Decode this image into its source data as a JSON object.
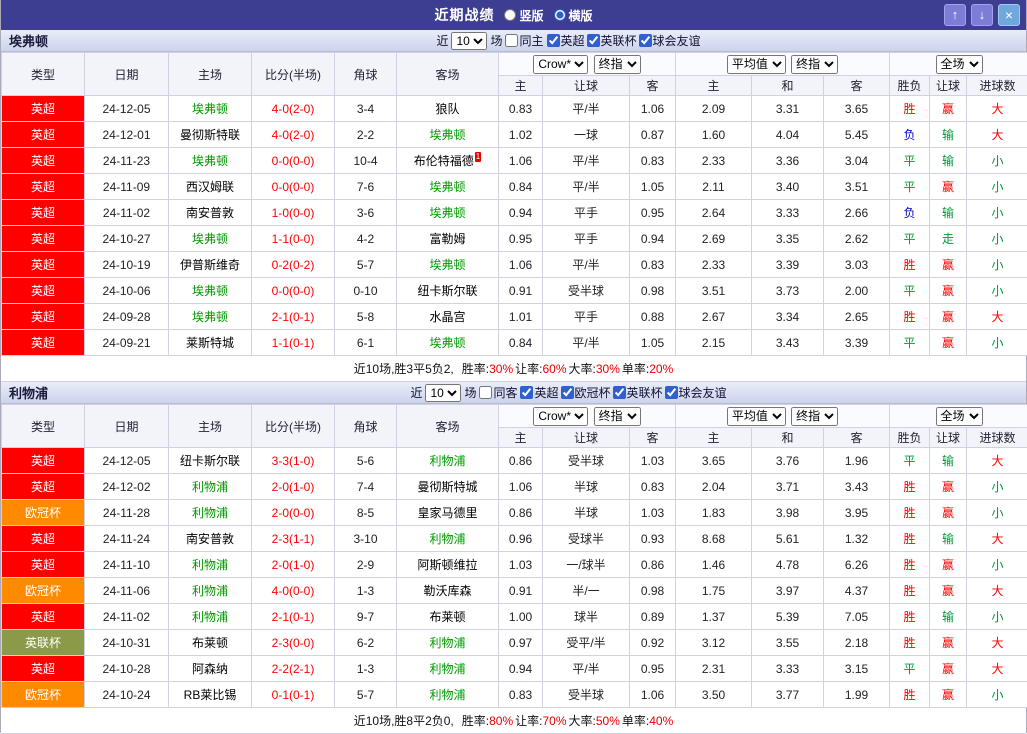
{
  "titlebar": {
    "title": "近期战绩",
    "layout_radios": [
      {
        "label": "竖版",
        "selected": false
      },
      {
        "label": "横版",
        "selected": true
      }
    ],
    "up_icon": "↑",
    "down_icon": "↓",
    "close_icon": "×"
  },
  "colors": {
    "focal_team": "#009900",
    "score": "#ff0000",
    "league": {
      "英超": "#fe0000",
      "欧冠杯": "#ff8a00",
      "英联杯": "#8a9a48"
    },
    "result": {
      "胜": "#ff0000",
      "平": "#009933",
      "负": "#0000cc"
    },
    "cover": {
      "赢": "#ff0000",
      "输": "#009933",
      "走": "#009933"
    },
    "goals": {
      "大": "#ff0000",
      "小": "#009933"
    },
    "stat_value": "#e60000"
  },
  "header": {
    "col_type": "类型",
    "col_date": "日期",
    "col_home": "主场",
    "col_score": "比分(半场)",
    "col_corner": "角球",
    "col_away": "客场",
    "asia_sub": [
      "主",
      "让球",
      "客"
    ],
    "euro_sub": [
      "主",
      "和",
      "客"
    ],
    "result_sub": [
      "胜负",
      "让球",
      "进球数"
    ]
  },
  "sections": [
    {
      "team": "埃弗顿",
      "filter": {
        "near": "近",
        "count": "10",
        "games": "场",
        "same": "同主",
        "leagues": [
          "英超",
          "英联杯",
          "球会友谊"
        ]
      },
      "selects": {
        "asia_company": "Crow*",
        "asia_time": "终指",
        "euro_company": "平均值",
        "euro_time": "终指",
        "scope": "全场"
      },
      "rows": [
        {
          "league": "英超",
          "date": "24-12-05",
          "home": "埃弗顿",
          "home_focal": true,
          "score": "4-0(2-0)",
          "corner": "3-4",
          "away": "狼队",
          "asia_home": "0.83",
          "handicap": "平/半",
          "asia_away": "1.06",
          "euro_home": "2.09",
          "euro_draw": "3.31",
          "euro_away": "3.65",
          "result": "胜",
          "cover": "赢",
          "goals": "大"
        },
        {
          "league": "英超",
          "date": "24-12-01",
          "home": "曼彻斯特联",
          "score": "4-0(2-0)",
          "corner": "2-2",
          "away": "埃弗顿",
          "away_focal": true,
          "asia_home": "1.02",
          "handicap": "一球",
          "asia_away": "0.87",
          "euro_home": "1.60",
          "euro_draw": "4.04",
          "euro_away": "5.45",
          "result": "负",
          "cover": "输",
          "goals": "大"
        },
        {
          "league": "英超",
          "date": "24-11-23",
          "home": "埃弗顿",
          "home_focal": true,
          "score": "0-0(0-0)",
          "corner": "10-4",
          "away": "布伦特福德",
          "away_note": "1",
          "asia_home": "1.06",
          "handicap": "平/半",
          "asia_away": "0.83",
          "euro_home": "2.33",
          "euro_draw": "3.36",
          "euro_away": "3.04",
          "result": "平",
          "cover": "输",
          "goals": "小"
        },
        {
          "league": "英超",
          "date": "24-11-09",
          "home": "西汉姆联",
          "score": "0-0(0-0)",
          "corner": "7-6",
          "away": "埃弗顿",
          "away_focal": true,
          "asia_home": "0.84",
          "handicap": "平/半",
          "asia_away": "1.05",
          "euro_home": "2.11",
          "euro_draw": "3.40",
          "euro_away": "3.51",
          "result": "平",
          "cover": "赢",
          "goals": "小"
        },
        {
          "league": "英超",
          "date": "24-11-02",
          "home": "南安普敦",
          "score": "1-0(0-0)",
          "corner": "3-6",
          "away": "埃弗顿",
          "away_focal": true,
          "asia_home": "0.94",
          "handicap": "平手",
          "asia_away": "0.95",
          "euro_home": "2.64",
          "euro_draw": "3.33",
          "euro_away": "2.66",
          "result": "负",
          "cover": "输",
          "goals": "小"
        },
        {
          "league": "英超",
          "date": "24-10-27",
          "home": "埃弗顿",
          "home_focal": true,
          "score": "1-1(0-0)",
          "corner": "4-2",
          "away": "富勒姆",
          "asia_home": "0.95",
          "handicap": "平手",
          "asia_away": "0.94",
          "euro_home": "2.69",
          "euro_draw": "3.35",
          "euro_away": "2.62",
          "result": "平",
          "cover": "走",
          "goals": "小"
        },
        {
          "league": "英超",
          "date": "24-10-19",
          "home": "伊普斯维奇",
          "score": "0-2(0-2)",
          "corner": "5-7",
          "away": "埃弗顿",
          "away_focal": true,
          "asia_home": "1.06",
          "handicap": "平/半",
          "asia_away": "0.83",
          "euro_home": "2.33",
          "euro_draw": "3.39",
          "euro_away": "3.03",
          "result": "胜",
          "cover": "赢",
          "goals": "小"
        },
        {
          "league": "英超",
          "date": "24-10-06",
          "home": "埃弗顿",
          "home_focal": true,
          "score": "0-0(0-0)",
          "corner": "0-10",
          "away": "纽卡斯尔联",
          "asia_home": "0.91",
          "handicap": "受半球",
          "asia_away": "0.98",
          "euro_home": "3.51",
          "euro_draw": "3.73",
          "euro_away": "2.00",
          "result": "平",
          "cover": "赢",
          "goals": "小"
        },
        {
          "league": "英超",
          "date": "24-09-28",
          "home": "埃弗顿",
          "home_focal": true,
          "score": "2-1(0-1)",
          "corner": "5-8",
          "away": "水晶宫",
          "asia_home": "1.01",
          "handicap": "平手",
          "asia_away": "0.88",
          "euro_home": "2.67",
          "euro_draw": "3.34",
          "euro_away": "2.65",
          "result": "胜",
          "cover": "赢",
          "goals": "大"
        },
        {
          "league": "英超",
          "date": "24-09-21",
          "home": "莱斯特城",
          "score": "1-1(0-1)",
          "corner": "6-1",
          "away": "埃弗顿",
          "away_focal": true,
          "asia_home": "0.84",
          "handicap": "平/半",
          "asia_away": "1.05",
          "euro_home": "2.15",
          "euro_draw": "3.43",
          "euro_away": "3.39",
          "result": "平",
          "cover": "赢",
          "goals": "小"
        }
      ],
      "summary": {
        "prefix": "近10场,胜3平5负2,",
        "stats": [
          {
            "label": "胜率:",
            "value": "30%"
          },
          {
            "label": "让率:",
            "value": "60%"
          },
          {
            "label": "大率:",
            "value": "30%"
          },
          {
            "label": "单率:",
            "value": "20%"
          }
        ]
      }
    },
    {
      "team": "利物浦",
      "filter": {
        "near": "近",
        "count": "10",
        "games": "场",
        "same": "同客",
        "leagues": [
          "英超",
          "欧冠杯",
          "英联杯",
          "球会友谊"
        ]
      },
      "selects": {
        "asia_company": "Crow*",
        "asia_time": "终指",
        "euro_company": "平均值",
        "euro_time": "终指",
        "scope": "全场"
      },
      "rows": [
        {
          "league": "英超",
          "date": "24-12-05",
          "home": "纽卡斯尔联",
          "score": "3-3(1-0)",
          "corner": "5-6",
          "away": "利物浦",
          "away_focal": true,
          "asia_home": "0.86",
          "handicap": "受半球",
          "asia_away": "1.03",
          "euro_home": "3.65",
          "euro_draw": "3.76",
          "euro_away": "1.96",
          "result": "平",
          "cover": "输",
          "goals": "大"
        },
        {
          "league": "英超",
          "date": "24-12-02",
          "home": "利物浦",
          "home_focal": true,
          "score": "2-0(1-0)",
          "corner": "7-4",
          "away": "曼彻斯特城",
          "asia_home": "1.06",
          "handicap": "半球",
          "asia_away": "0.83",
          "euro_home": "2.04",
          "euro_draw": "3.71",
          "euro_away": "3.43",
          "result": "胜",
          "cover": "赢",
          "goals": "小"
        },
        {
          "league": "欧冠杯",
          "date": "24-11-28",
          "home": "利物浦",
          "home_focal": true,
          "score": "2-0(0-0)",
          "corner": "8-5",
          "away": "皇家马德里",
          "asia_home": "0.86",
          "handicap": "半球",
          "asia_away": "1.03",
          "euro_home": "1.83",
          "euro_draw": "3.98",
          "euro_away": "3.95",
          "result": "胜",
          "cover": "赢",
          "goals": "小"
        },
        {
          "league": "英超",
          "date": "24-11-24",
          "home": "南安普敦",
          "score": "2-3(1-1)",
          "corner": "3-10",
          "away": "利物浦",
          "away_focal": true,
          "asia_home": "0.96",
          "handicap": "受球半",
          "asia_away": "0.93",
          "euro_home": "8.68",
          "euro_draw": "5.61",
          "euro_away": "1.32",
          "result": "胜",
          "cover": "输",
          "goals": "大"
        },
        {
          "league": "英超",
          "date": "24-11-10",
          "home": "利物浦",
          "home_focal": true,
          "score": "2-0(1-0)",
          "corner": "2-9",
          "away": "阿斯顿维拉",
          "asia_home": "1.03",
          "handicap": "一/球半",
          "asia_away": "0.86",
          "euro_home": "1.46",
          "euro_draw": "4.78",
          "euro_away": "6.26",
          "result": "胜",
          "cover": "赢",
          "goals": "小"
        },
        {
          "league": "欧冠杯",
          "date": "24-11-06",
          "home": "利物浦",
          "home_focal": true,
          "score": "4-0(0-0)",
          "corner": "1-3",
          "away": "勒沃库森",
          "asia_home": "0.91",
          "handicap": "半/一",
          "asia_away": "0.98",
          "euro_home": "1.75",
          "euro_draw": "3.97",
          "euro_away": "4.37",
          "result": "胜",
          "cover": "赢",
          "goals": "大"
        },
        {
          "league": "英超",
          "date": "24-11-02",
          "home": "利物浦",
          "home_focal": true,
          "score": "2-1(0-1)",
          "corner": "9-7",
          "away": "布莱顿",
          "asia_home": "1.00",
          "handicap": "球半",
          "asia_away": "0.89",
          "euro_home": "1.37",
          "euro_draw": "5.39",
          "euro_away": "7.05",
          "result": "胜",
          "cover": "输",
          "goals": "小"
        },
        {
          "league": "英联杯",
          "date": "24-10-31",
          "home": "布莱顿",
          "score": "2-3(0-0)",
          "corner": "6-2",
          "away": "利物浦",
          "away_focal": true,
          "asia_home": "0.97",
          "handicap": "受平/半",
          "asia_away": "0.92",
          "euro_home": "3.12",
          "euro_draw": "3.55",
          "euro_away": "2.18",
          "result": "胜",
          "cover": "赢",
          "goals": "大"
        },
        {
          "league": "英超",
          "date": "24-10-28",
          "home": "阿森纳",
          "score": "2-2(2-1)",
          "corner": "1-3",
          "away": "利物浦",
          "away_focal": true,
          "asia_home": "0.94",
          "handicap": "平/半",
          "asia_away": "0.95",
          "euro_home": "2.31",
          "euro_draw": "3.33",
          "euro_away": "3.15",
          "result": "平",
          "cover": "赢",
          "goals": "大"
        },
        {
          "league": "欧冠杯",
          "date": "24-10-24",
          "home": "RB莱比锡",
          "score": "0-1(0-1)",
          "corner": "5-7",
          "away": "利物浦",
          "away_focal": true,
          "asia_home": "0.83",
          "handicap": "受半球",
          "asia_away": "1.06",
          "euro_home": "3.50",
          "euro_draw": "3.77",
          "euro_away": "1.99",
          "result": "胜",
          "cover": "赢",
          "goals": "小"
        }
      ],
      "summary": {
        "prefix": "近10场,胜8平2负0,",
        "stats": [
          {
            "label": "胜率:",
            "value": "80%"
          },
          {
            "label": "让率:",
            "value": "70%"
          },
          {
            "label": "大率:",
            "value": "50%"
          },
          {
            "label": "单率:",
            "value": "40%"
          }
        ]
      }
    }
  ]
}
